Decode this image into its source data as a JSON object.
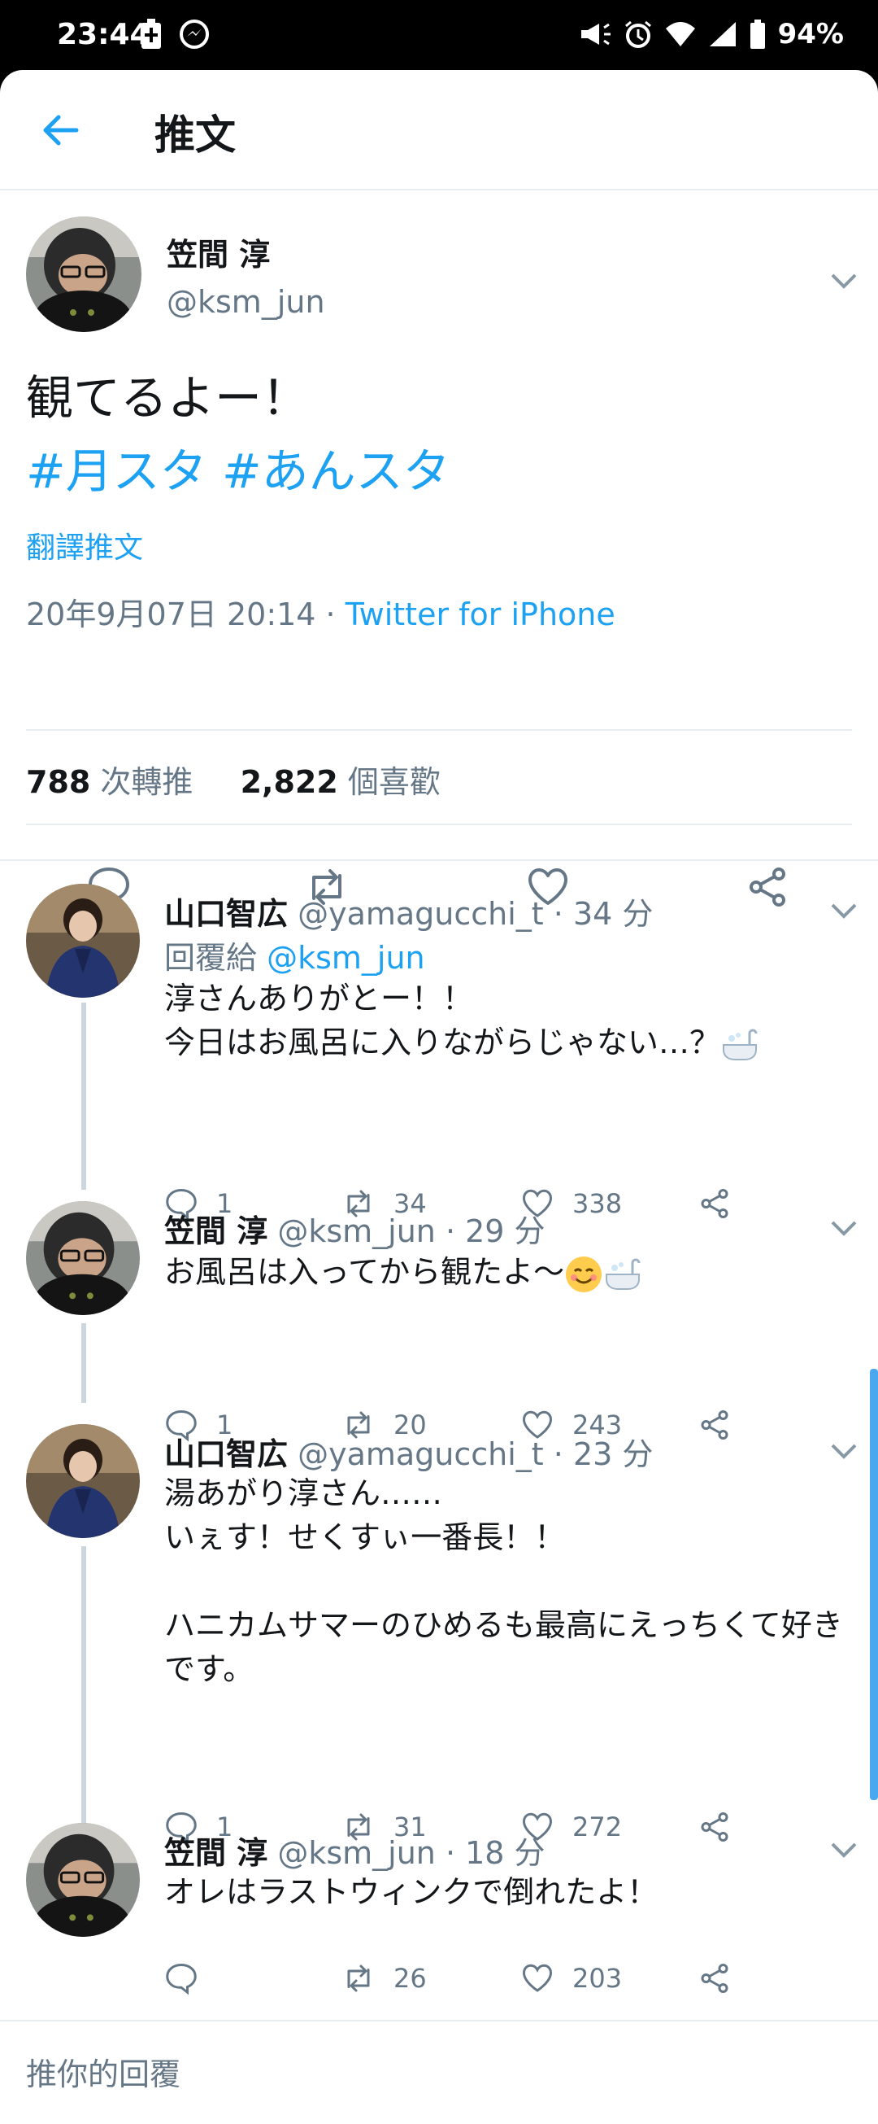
{
  "status_bar": {
    "time": "23:44",
    "battery": "94%"
  },
  "header": {
    "title": "推文"
  },
  "main_tweet": {
    "name": "笠間 淳",
    "handle": "@ksm_jun",
    "text_line1": "観てるよー！",
    "hashtag1": "#月スタ",
    "hashtag2": "#あんスタ",
    "translate": "翻譯推文",
    "timestamp": "20年9月07日 20:14 · ",
    "source": "Twitter for iPhone",
    "retweets_count": "788",
    "retweets_label": " 次轉推",
    "likes_count": "2,822",
    "likes_label": " 個喜歡"
  },
  "replies": [
    {
      "name": "山口智広",
      "meta": " @yamagucchi_t · 34 分",
      "reply_to_label": "回覆給 ",
      "reply_to_handle": "@ksm_jun",
      "text": "淳さんありがとー！！\n今日はお風呂に入りながらじゃない…？",
      "replies": "1",
      "retweets": "34",
      "likes": "338"
    },
    {
      "name": "笠間 淳",
      "meta": " @ksm_jun · 29 分",
      "text": "お風呂は入ってから観たよ〜",
      "replies": "1",
      "retweets": "20",
      "likes": "243"
    },
    {
      "name": "山口智広",
      "meta": " @yamagucchi_t · 23 分",
      "text": "湯あがり淳さん……\nいぇす！せくすぃ一番長！！\n\nハニカムサマーのひめるも最高にえっちくて好きです。",
      "replies": "1",
      "retweets": "31",
      "likes": "272"
    },
    {
      "name": "笠間 淳",
      "meta": " @ksm_jun · 18 分",
      "text": "オレはラストウィンクで倒れたよ！",
      "replies": "",
      "retweets": "26",
      "likes": "203"
    }
  ],
  "compose": {
    "placeholder": "推你的回覆"
  },
  "colors": {
    "accent": "#1da1f2",
    "secondary_text": "#657786",
    "divider": "#e6ecf0"
  }
}
